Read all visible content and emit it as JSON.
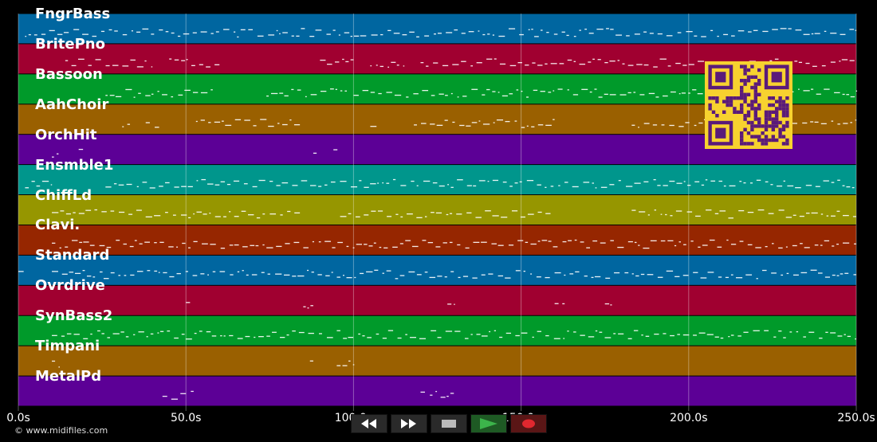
{
  "tracks": [
    {
      "label": "FngrBass",
      "color": "#0066a0"
    },
    {
      "label": "BritePno",
      "color": "#a00030"
    },
    {
      "label": "Bassoon",
      "color": "#009a2a"
    },
    {
      "label": "AahChoir",
      "color": "#9a6000"
    },
    {
      "label": "OrchHit",
      "color": "#5c0096"
    },
    {
      "label": "Ensmble1",
      "color": "#00968c"
    },
    {
      "label": "ChiffLd",
      "color": "#969600"
    },
    {
      "label": "Clavi.",
      "color": "#962600"
    },
    {
      "label": "Standard",
      "color": "#0066a0"
    },
    {
      "label": "Ovrdrive",
      "color": "#a00030"
    },
    {
      "label": "SynBass2",
      "color": "#009a2a"
    },
    {
      "label": "Timpani",
      "color": "#9a6000"
    },
    {
      "label": "MetalPd",
      "color": "#5c0096"
    }
  ],
  "time_axis": {
    "min": 0,
    "max": 250,
    "ticks": [
      "0.0s",
      "50.0s",
      "100.0s",
      "150.0s",
      "200.0s",
      "250.0s"
    ]
  },
  "copyright": "© www.midifiles.com",
  "controls": [
    "rewind",
    "fast-forward",
    "stop",
    "play",
    "record"
  ],
  "colors": {
    "background": "#000000",
    "note": "#ffffff",
    "qr_bg": "#f7d22f",
    "qr_fg": "#5a1a7a",
    "play": "#3cb44b",
    "record": "#e0282f"
  },
  "notes": [
    {
      "track": 0,
      "segments": [
        [
          2,
          250
        ]
      ]
    },
    {
      "track": 1,
      "segments": [
        [
          14,
          40
        ],
        [
          45,
          60
        ],
        [
          90,
          100
        ],
        [
          105,
          115
        ],
        [
          120,
          250
        ]
      ]
    },
    {
      "track": 2,
      "segments": [
        [
          26,
          58
        ],
        [
          74,
          98
        ],
        [
          100,
          250
        ]
      ]
    },
    {
      "track": 3,
      "segments": [
        [
          31,
          34
        ],
        [
          38,
          42
        ],
        [
          53,
          84
        ],
        [
          105,
          108
        ],
        [
          118,
          160
        ],
        [
          183,
          250
        ]
      ]
    },
    {
      "track": 4,
      "segments": [
        [
          10,
          12
        ],
        [
          18,
          20
        ],
        [
          88,
          89
        ],
        [
          94,
          96
        ]
      ]
    },
    {
      "track": 5,
      "segments": [
        [
          2,
          10
        ],
        [
          26,
          250
        ]
      ]
    },
    {
      "track": 6,
      "segments": [
        [
          10,
          84
        ],
        [
          96,
          160
        ],
        [
          183,
          250
        ]
      ]
    },
    {
      "track": 7,
      "segments": [
        [
          10,
          250
        ]
      ]
    },
    {
      "track": 8,
      "segments": [
        [
          0,
          2
        ],
        [
          10,
          250
        ]
      ]
    },
    {
      "track": 9,
      "segments": [
        [
          50,
          52
        ],
        [
          85,
          88
        ],
        [
          128,
          130
        ],
        [
          160,
          163
        ],
        [
          175,
          178
        ]
      ]
    },
    {
      "track": 10,
      "segments": [
        [
          10,
          250
        ]
      ]
    },
    {
      "track": 11,
      "segments": [
        [
          10,
          12
        ],
        [
          87,
          88
        ],
        [
          95,
          100
        ]
      ]
    },
    {
      "track": 12,
      "segments": [
        [
          43,
          53
        ],
        [
          120,
          130
        ]
      ]
    }
  ]
}
